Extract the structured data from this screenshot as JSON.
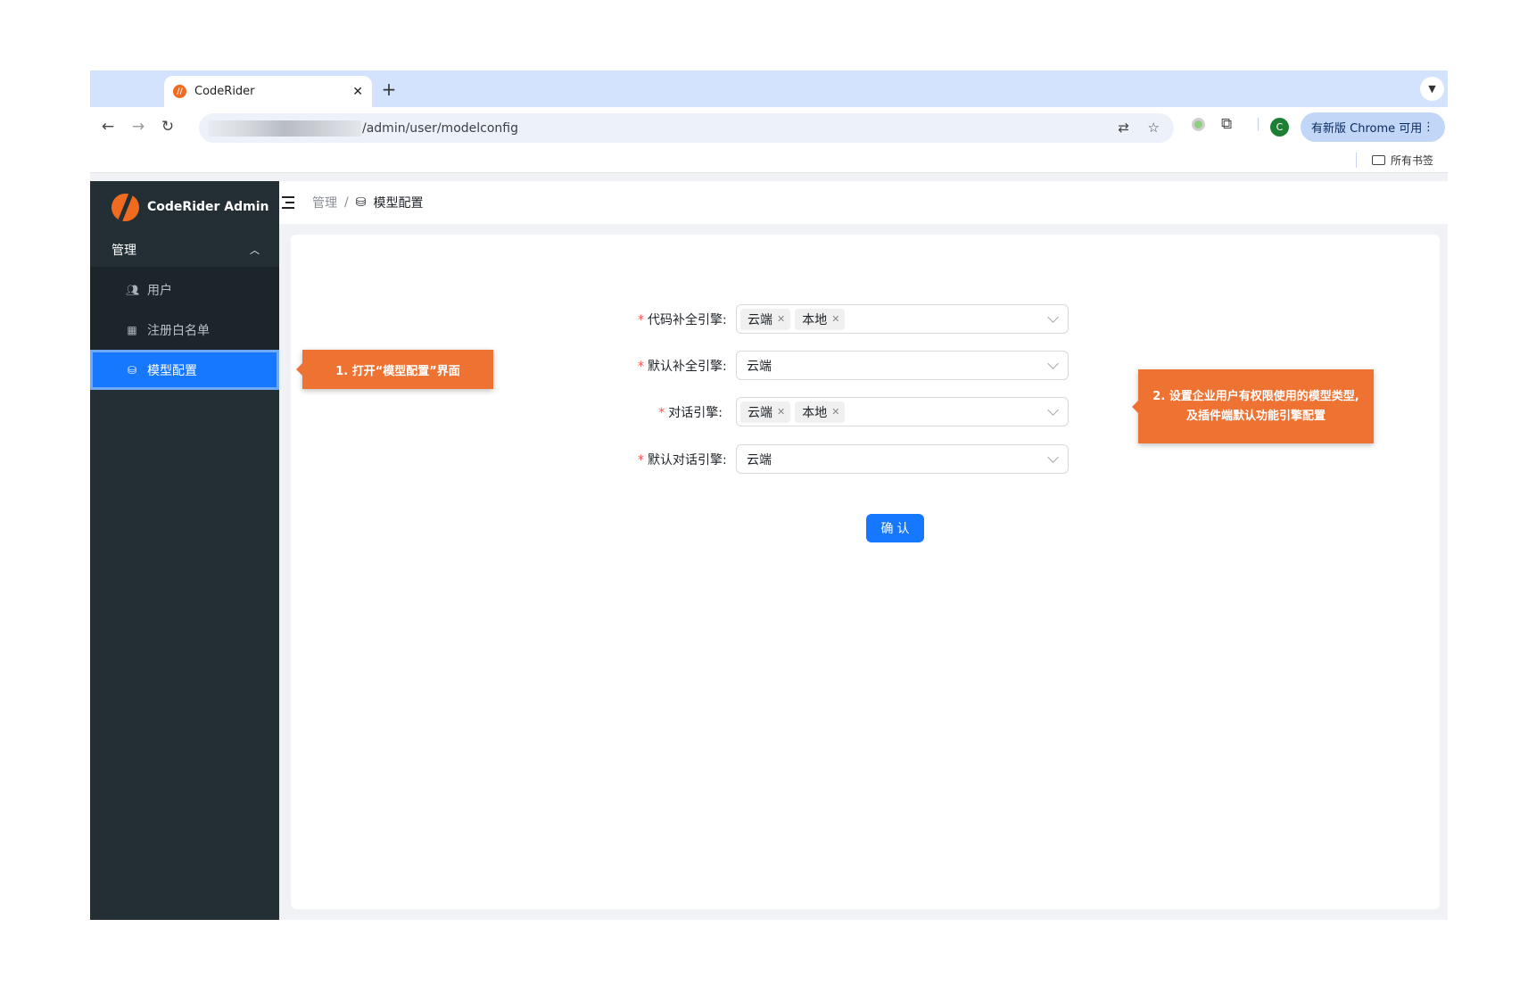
{
  "browser": {
    "tab_title": "CodeRider",
    "favicon_text": "//",
    "url_path": "/admin/user/modelconfig",
    "update_label": "有新版 Chrome 可用",
    "profile_initial": "C",
    "bookmarks_all": "所有书签"
  },
  "app": {
    "brand": "CodeRider Admin",
    "menu_group": "管理",
    "menu_items": [
      {
        "label": "用户",
        "icon": "users-icon"
      },
      {
        "label": "注册白名单",
        "icon": "form-icon"
      },
      {
        "label": "模型配置",
        "icon": "database-icon",
        "active": true
      }
    ],
    "breadcrumb": {
      "parent": "管理",
      "separator": "/",
      "current": "模型配置"
    }
  },
  "form": {
    "fields": [
      {
        "label": "代码补全引擎:",
        "type": "multi",
        "tags": [
          "云端",
          "本地"
        ]
      },
      {
        "label": "默认补全引擎:",
        "type": "single",
        "value": "云端"
      },
      {
        "label": "对话引擎:",
        "type": "multi",
        "tags": [
          "云端",
          "本地"
        ]
      },
      {
        "label": "默认对话引擎:",
        "type": "single",
        "value": "云端"
      }
    ],
    "submit_label": "确认"
  },
  "annotations": {
    "step1": "1. 打开“模型配置”界面",
    "step2_line1": "2. 设置企业用户有权限使用的模型类型,",
    "step2_line2": "及插件端默认功能引擎配置"
  },
  "colors": {
    "sidebar_bg": "#232f35",
    "primary": "#1677ff",
    "annotation": "#ee7232",
    "required": "#ff4d4f"
  }
}
